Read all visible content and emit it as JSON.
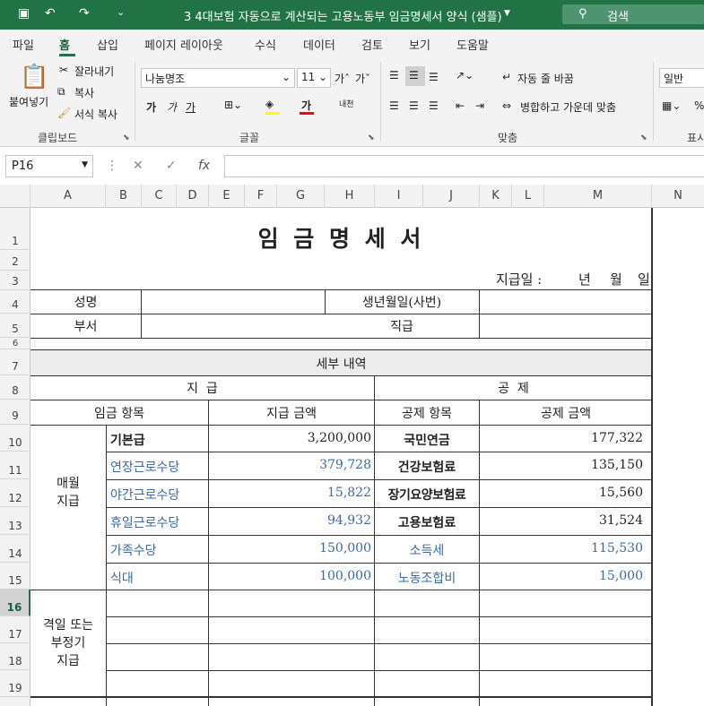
{
  "titlebar": {
    "doc_title": "3 4대보험 자동으로 계산되는 고용노동부 임금명세서 양식 (샘플)",
    "search": "검색"
  },
  "menu": [
    "파일",
    "홈",
    "삽입",
    "페이지 레이아웃",
    "수식",
    "데이터",
    "검토",
    "보기",
    "도움말"
  ],
  "ribbon": {
    "clipboard": {
      "paste": "붙여넣기",
      "cut": "잘라내기",
      "copy": "복사",
      "format": "서식 복사",
      "label": "클립보드"
    },
    "font": {
      "name": "나눔명조",
      "size": "11",
      "bold": "가",
      "italic": "가",
      "underline": "가",
      "label": "글꼴"
    },
    "align": {
      "wrap": "자동 줄 바꿈",
      "merge": "병합하고 가운데 맞춤",
      "label": "맞춤"
    },
    "number": {
      "format": "일반",
      "label": "표시"
    }
  },
  "formula": {
    "cell_ref": "P16",
    "fx": "fx",
    "value": ""
  },
  "columns": [
    "A",
    "B",
    "C",
    "D",
    "E",
    "F",
    "G",
    "H",
    "I",
    "J",
    "K",
    "L",
    "M",
    "N"
  ],
  "rows": [
    "1",
    "2",
    "3",
    "4",
    "5",
    "6",
    "7",
    "8",
    "9",
    "10",
    "11",
    "12",
    "13",
    "14",
    "15",
    "16",
    "17",
    "18",
    "19"
  ],
  "sheet": {
    "title": "임 금 명 세 서",
    "pay_date": "지급일 :",
    "y": "년",
    "m": "월",
    "d": "일",
    "name": "성명",
    "birth": "생년월일(사번)",
    "dept": "부서",
    "position": "직급",
    "details": "세부 내역",
    "pay": "지  급",
    "deduct": "공  제",
    "pay_item": "임금 항목",
    "pay_amount": "지급 금액",
    "ded_item": "공제 항목",
    "ded_amount": "공제 금액",
    "monthly": "매월\n지급",
    "irregular": "격일 또는\n부정기\n지급",
    "items": [
      {
        "pay": "기본급",
        "amt": "3,200,000",
        "ded": "국민연금",
        "damt": "177,322"
      },
      {
        "pay": "연장근로수당",
        "amt": "379,728",
        "ded": "건강보험료",
        "damt": "135,150"
      },
      {
        "pay": "야간근로수당",
        "amt": "15,822",
        "ded": "장기요양보험료",
        "damt": "15,560"
      },
      {
        "pay": "휴일근로수당",
        "amt": "94,932",
        "ded": "고용보험료",
        "damt": "31,524"
      },
      {
        "pay": "가족수당",
        "amt": "150,000",
        "ded": "소득세",
        "damt": "115,530"
      },
      {
        "pay": "식대",
        "amt": "100,000",
        "ded": "노동조합비",
        "damt": "15,000"
      }
    ]
  }
}
